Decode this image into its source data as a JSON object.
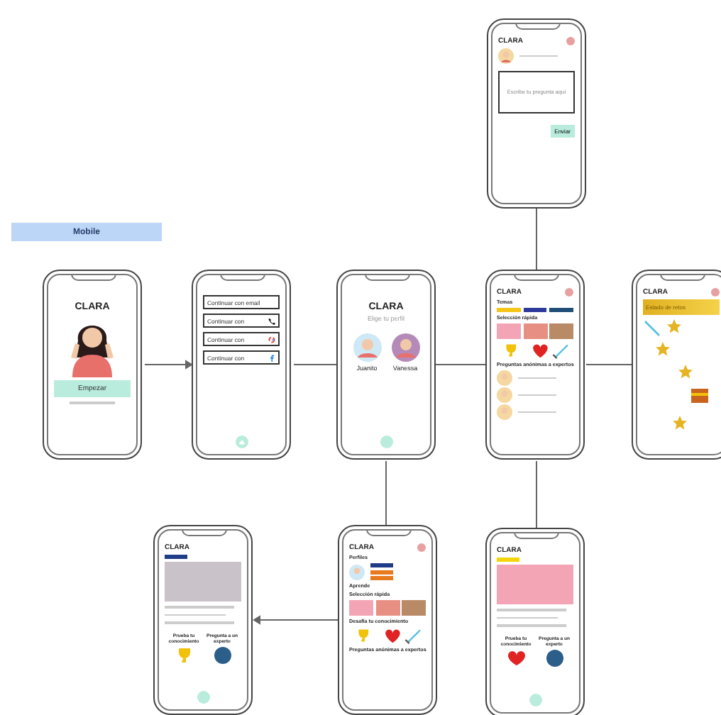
{
  "label": "Mobile",
  "screens": [
    {
      "kind": "welcome",
      "title": "CLARA",
      "button": "Empezar"
    },
    {
      "kind": "login",
      "options": [
        {
          "label": "Continuar con email",
          "kind": "email"
        },
        {
          "label": "Continuar con",
          "kind": "phone"
        },
        {
          "label": "Continuar con",
          "kind": "google"
        },
        {
          "label": "Continuar con",
          "kind": "facebook"
        }
      ]
    },
    {
      "kind": "profiles",
      "title": "CLARA",
      "subtitle": "Elige tu perfil",
      "profiles": [
        {
          "name": "Juanito",
          "color": "#cfe8f5"
        },
        {
          "name": "Vanessa",
          "color": "#b58ab8"
        }
      ]
    },
    {
      "kind": "home",
      "title": "CLARA",
      "topics_title": "Temas",
      "chips": [
        {
          "color": "#f5c518"
        },
        {
          "color": "#2d3a9c"
        },
        {
          "color": "#1f4e79"
        }
      ],
      "quick_title": "Selección rápida",
      "experts_title": "Preguntas anónimas a expertos"
    },
    {
      "kind": "rewards",
      "title": "CLARA",
      "banner": "Estado de retos"
    },
    {
      "kind": "question",
      "title": "CLARA",
      "placeholder": "Escribe tu pregunta aquí",
      "button": "Enviar"
    },
    {
      "kind": "article",
      "title": "CLARA",
      "cards": [
        "Prueba tu conocimiento",
        "Pregunta a un experto"
      ]
    },
    {
      "kind": "dashboard",
      "title": "CLARA",
      "profiles_title": "Perfiles",
      "learn_title": "Aprende",
      "quick_title": "Selección rápida",
      "challenge_title": "Desafía tu conocimiento",
      "experts_title": "Preguntas anónimas a expertos"
    },
    {
      "kind": "video",
      "title": "CLARA",
      "cards": [
        "Prueba tu conocimiento",
        "Pregunta a un experto"
      ]
    }
  ]
}
